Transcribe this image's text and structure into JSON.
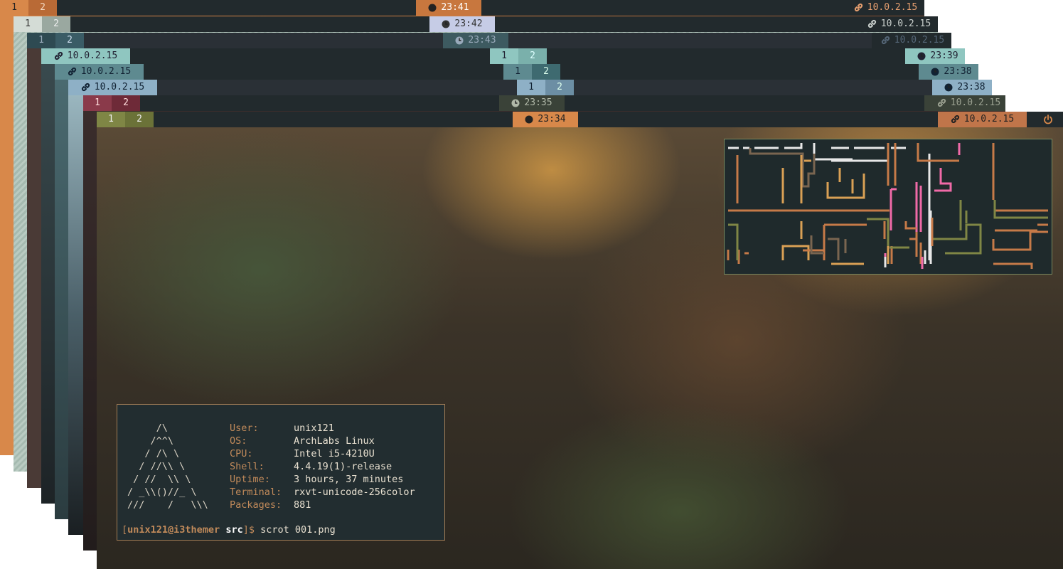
{
  "bars": [
    {
      "ws1": "1",
      "ws2": "2",
      "time": "23:41",
      "ip": "10.0.2.15"
    },
    {
      "ws1": "1",
      "ws2": "2",
      "time": "23:42",
      "ip": "10.0.2.15"
    },
    {
      "ws1": "1",
      "ws2": "2",
      "time": "23:43",
      "ip": "10.0.2.15"
    },
    {
      "ws1": "1",
      "ws2": "2",
      "time": "23:39",
      "ip": "10.0.2.15"
    },
    {
      "ws1": "1",
      "ws2": "2",
      "time": "23:38",
      "ip": "10.0.2.15"
    },
    {
      "ws1": "1",
      "ws2": "2",
      "time": "23:38",
      "ip": "10.0.2.15"
    },
    {
      "ws1": "1",
      "ws2": "2",
      "time": "23:35",
      "ip": "10.0.2.15"
    },
    {
      "ws1": "1",
      "ws2": "2",
      "time": "23:34",
      "ip": "10.0.2.15"
    }
  ],
  "icons": {
    "clock": "clock-icon",
    "network": "link-icon",
    "power": "power-icon"
  },
  "terminal": {
    "ascii_art": "     /\\\n    /^^\\\n   / /\\ \\\n  / //\\\\ \\\n / //  \\\\ \\\n/ _\\\\()//_ \\\n///    /   \\\\\\",
    "info": [
      {
        "key": "User:",
        "value": "unix121"
      },
      {
        "key": "OS:",
        "value": "ArchLabs Linux"
      },
      {
        "key": "CPU:",
        "value": "Intel i5-4210U"
      },
      {
        "key": "Shell:",
        "value": "4.4.19(1)-release"
      },
      {
        "key": "Uptime:",
        "value": "3 hours, 37 minutes"
      },
      {
        "key": "Terminal:",
        "value": "rxvt-unicode-256color"
      },
      {
        "key": "Packages:",
        "value": "881"
      }
    ],
    "prompt_open": "[",
    "prompt_user": "unix121@i3themer",
    "prompt_dir": "src",
    "prompt_close": "]$",
    "command": "scrot 001.png"
  },
  "colors": {
    "bar_bg": "#222a2d",
    "accent_orange": "#d8884a",
    "accent_olive": "#7f8645",
    "terminal_label": "#c18a5a"
  }
}
